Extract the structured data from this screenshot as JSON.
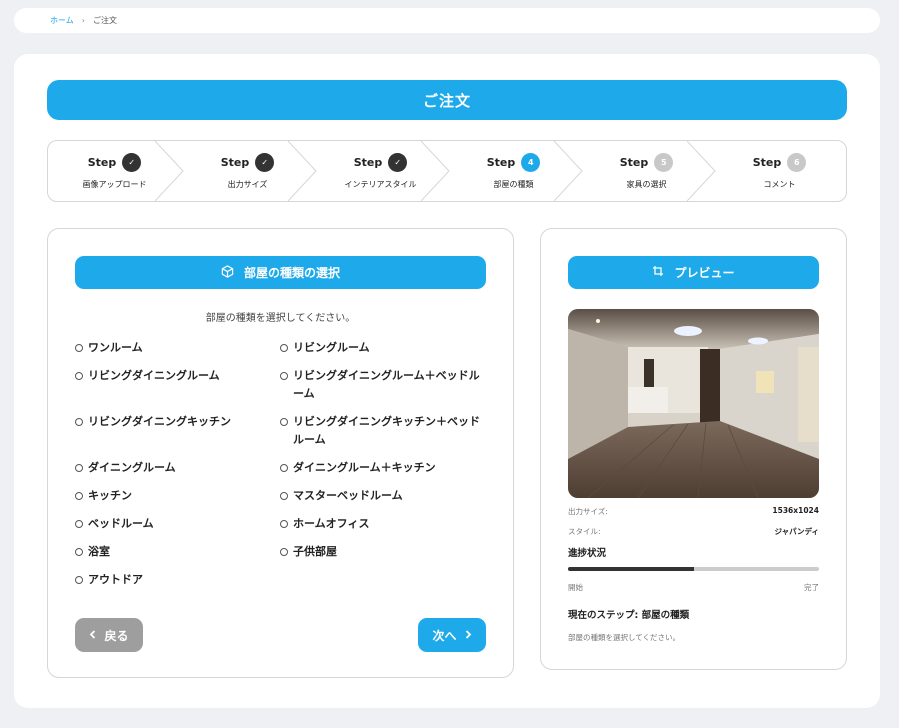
{
  "breadcrumb": {
    "home": "ホーム",
    "separator": "›",
    "current": "ご注文"
  },
  "page_title": "ご注文",
  "steps": [
    {
      "step_label": "Step",
      "name": "画像アップロード",
      "badge": "✓",
      "status": "done"
    },
    {
      "step_label": "Step",
      "name": "出力サイズ",
      "badge": "✓",
      "status": "done"
    },
    {
      "step_label": "Step",
      "name": "インテリアスタイル",
      "badge": "✓",
      "status": "done"
    },
    {
      "step_label": "Step",
      "name": "部屋の種類",
      "badge": "4",
      "status": "active"
    },
    {
      "step_label": "Step",
      "name": "家具の選択",
      "badge": "5",
      "status": "pending"
    },
    {
      "step_label": "Step",
      "name": "コメント",
      "badge": "6",
      "status": "pending"
    }
  ],
  "room_panel": {
    "title": "部屋の種類の選択",
    "icon": "cube-icon",
    "instruction": "部屋の種類を選択してください。",
    "options": [
      [
        "ワンルーム",
        "リビングルーム"
      ],
      [
        "リビングダイニングルーム",
        "リビングダイニングルーム＋ベッドルーム"
      ],
      [
        "リビングダイニングキッチン",
        "リビングダイニングキッチン＋ベッドルーム"
      ],
      [
        "ダイニングルーム",
        "ダイニングルーム＋キッチン"
      ],
      [
        "キッチン",
        "マスターベッドルーム"
      ],
      [
        "ベッドルーム",
        "ホームオフィス"
      ],
      [
        "浴室",
        "子供部屋"
      ],
      [
        "アウトドア"
      ]
    ],
    "back_label": "戻る",
    "next_label": "次へ"
  },
  "preview_panel": {
    "title": "プレビュー",
    "icon": "crop-icon",
    "output_size_label": "出力サイズ:",
    "output_size_value": "1536x1024",
    "style_label": "スタイル:",
    "style_value": "ジャパンディ",
    "progress_title": "進捗状況",
    "progress_fraction": 0.5,
    "progress_start": "開始",
    "progress_end": "完了",
    "current_step": "現在のステップ: 部屋の種類",
    "current_desc": "部屋の種類を選択してください。"
  },
  "colors": {
    "accent": "#1eaaea",
    "done": "#333333",
    "pending": "#c8c8c8",
    "back_button": "#9e9e9e"
  }
}
